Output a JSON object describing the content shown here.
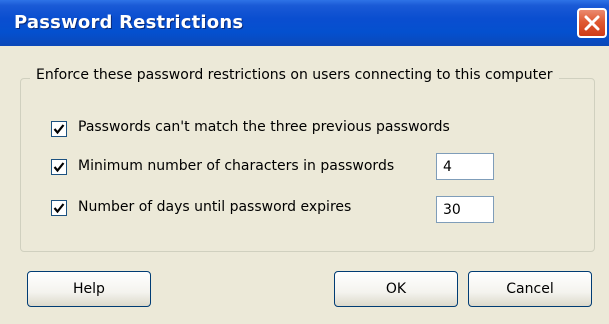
{
  "window": {
    "title": "Password Restrictions",
    "close_icon": "close-icon"
  },
  "group": {
    "legend": "Enforce these password restrictions on users connecting to this computer"
  },
  "options": [
    {
      "label": "Passwords can't match the three previous passwords",
      "checked": true
    },
    {
      "label": "Minimum number of characters in passwords",
      "checked": true,
      "value": "4"
    },
    {
      "label": "Number of days until password expires",
      "checked": true,
      "value": "30"
    }
  ],
  "buttons": {
    "help": "Help",
    "ok": "OK",
    "cancel": "Cancel"
  },
  "colors": {
    "title_bar": "#0450cf",
    "dialog_bg": "#ece9d8",
    "close_button": "#e05a33"
  }
}
